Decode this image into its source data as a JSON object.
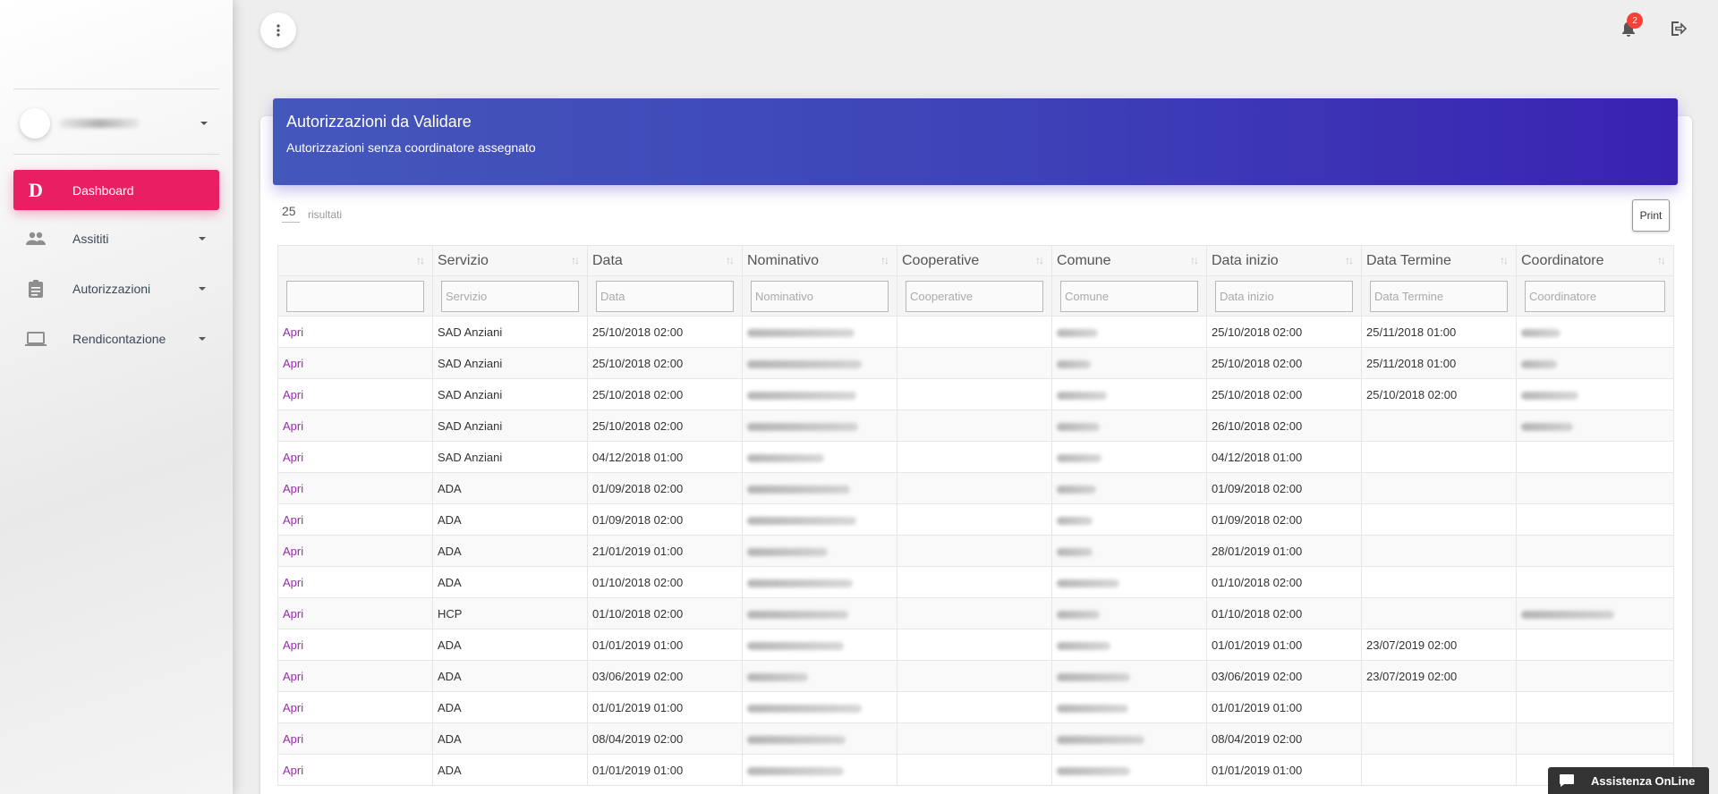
{
  "sidebar": {
    "user_name": "",
    "items": [
      {
        "label": "Dashboard",
        "icon": "D"
      },
      {
        "label": "Assititi",
        "icon": "people-icon"
      },
      {
        "label": "Autorizzazioni",
        "icon": "clipboard-icon"
      },
      {
        "label": "Rendicontazione",
        "icon": "laptop-icon"
      }
    ]
  },
  "topbar": {
    "notification_count": "2"
  },
  "card": {
    "title": "Autorizzazioni da Validare",
    "subtitle": "Autorizzazioni senza coordinatore assegnato",
    "page_size": "25",
    "results_label": "risultati",
    "print_label": "Print"
  },
  "table": {
    "columns": [
      "",
      "Servizio",
      "Data",
      "Nominativo",
      "Cooperative",
      "Comune",
      "Data inizio",
      "Data Termine",
      "Coordinatore"
    ],
    "filters": [
      "",
      "Servizio",
      "Data",
      "Nominativo",
      "Cooperative",
      "Comune",
      "Data inizio",
      "Data Termine",
      "Coordinatore"
    ],
    "rows": [
      {
        "action": "Apri",
        "servizio": "SAD Anziani",
        "data": "25/10/2018 02:00",
        "data_inizio": "25/10/2018 02:00",
        "data_termine": "25/11/2018 01:00"
      },
      {
        "action": "Apri",
        "servizio": "SAD Anziani",
        "data": "25/10/2018 02:00",
        "data_inizio": "25/10/2018 02:00",
        "data_termine": "25/11/2018 01:00"
      },
      {
        "action": "Apri",
        "servizio": "SAD Anziani",
        "data": "25/10/2018 02:00",
        "data_inizio": "25/10/2018 02:00",
        "data_termine": "25/10/2018 02:00"
      },
      {
        "action": "Apri",
        "servizio": "SAD Anziani",
        "data": "25/10/2018 02:00",
        "data_inizio": "26/10/2018 02:00",
        "data_termine": ""
      },
      {
        "action": "Apri",
        "servizio": "SAD Anziani",
        "data": "04/12/2018 01:00",
        "data_inizio": "04/12/2018 01:00",
        "data_termine": ""
      },
      {
        "action": "Apri",
        "servizio": "ADA",
        "data": "01/09/2018 02:00",
        "data_inizio": "01/09/2018 02:00",
        "data_termine": ""
      },
      {
        "action": "Apri",
        "servizio": "ADA",
        "data": "01/09/2018 02:00",
        "data_inizio": "01/09/2018 02:00",
        "data_termine": ""
      },
      {
        "action": "Apri",
        "servizio": "ADA",
        "data": "21/01/2019 01:00",
        "data_inizio": "28/01/2019 01:00",
        "data_termine": ""
      },
      {
        "action": "Apri",
        "servizio": "ADA",
        "data": "01/10/2018 02:00",
        "data_inizio": "01/10/2018 02:00",
        "data_termine": ""
      },
      {
        "action": "Apri",
        "servizio": "HCP",
        "data": "01/10/2018 02:00",
        "data_inizio": "01/10/2018 02:00",
        "data_termine": ""
      },
      {
        "action": "Apri",
        "servizio": "ADA",
        "data": "01/01/2019 01:00",
        "data_inizio": "01/01/2019 01:00",
        "data_termine": "23/07/2019 02:00"
      },
      {
        "action": "Apri",
        "servizio": "ADA",
        "data": "03/06/2019 02:00",
        "data_inizio": "03/06/2019 02:00",
        "data_termine": "23/07/2019 02:00"
      },
      {
        "action": "Apri",
        "servizio": "ADA",
        "data": "01/01/2019 01:00",
        "data_inizio": "01/01/2019 01:00",
        "data_termine": ""
      },
      {
        "action": "Apri",
        "servizio": "ADA",
        "data": "08/04/2019 02:00",
        "data_inizio": "08/04/2019 02:00",
        "data_termine": ""
      },
      {
        "action": "Apri",
        "servizio": "ADA",
        "data": "01/01/2019 01:00",
        "data_inizio": "01/01/2019 01:00",
        "data_termine": ""
      }
    ]
  },
  "chat": {
    "label": "Assistenza OnLine"
  },
  "colors": {
    "accent": "#e91e63",
    "header_start": "#4457bb",
    "header_end": "#3922b2",
    "link": "#9c27b0",
    "badge": "#f44336"
  }
}
